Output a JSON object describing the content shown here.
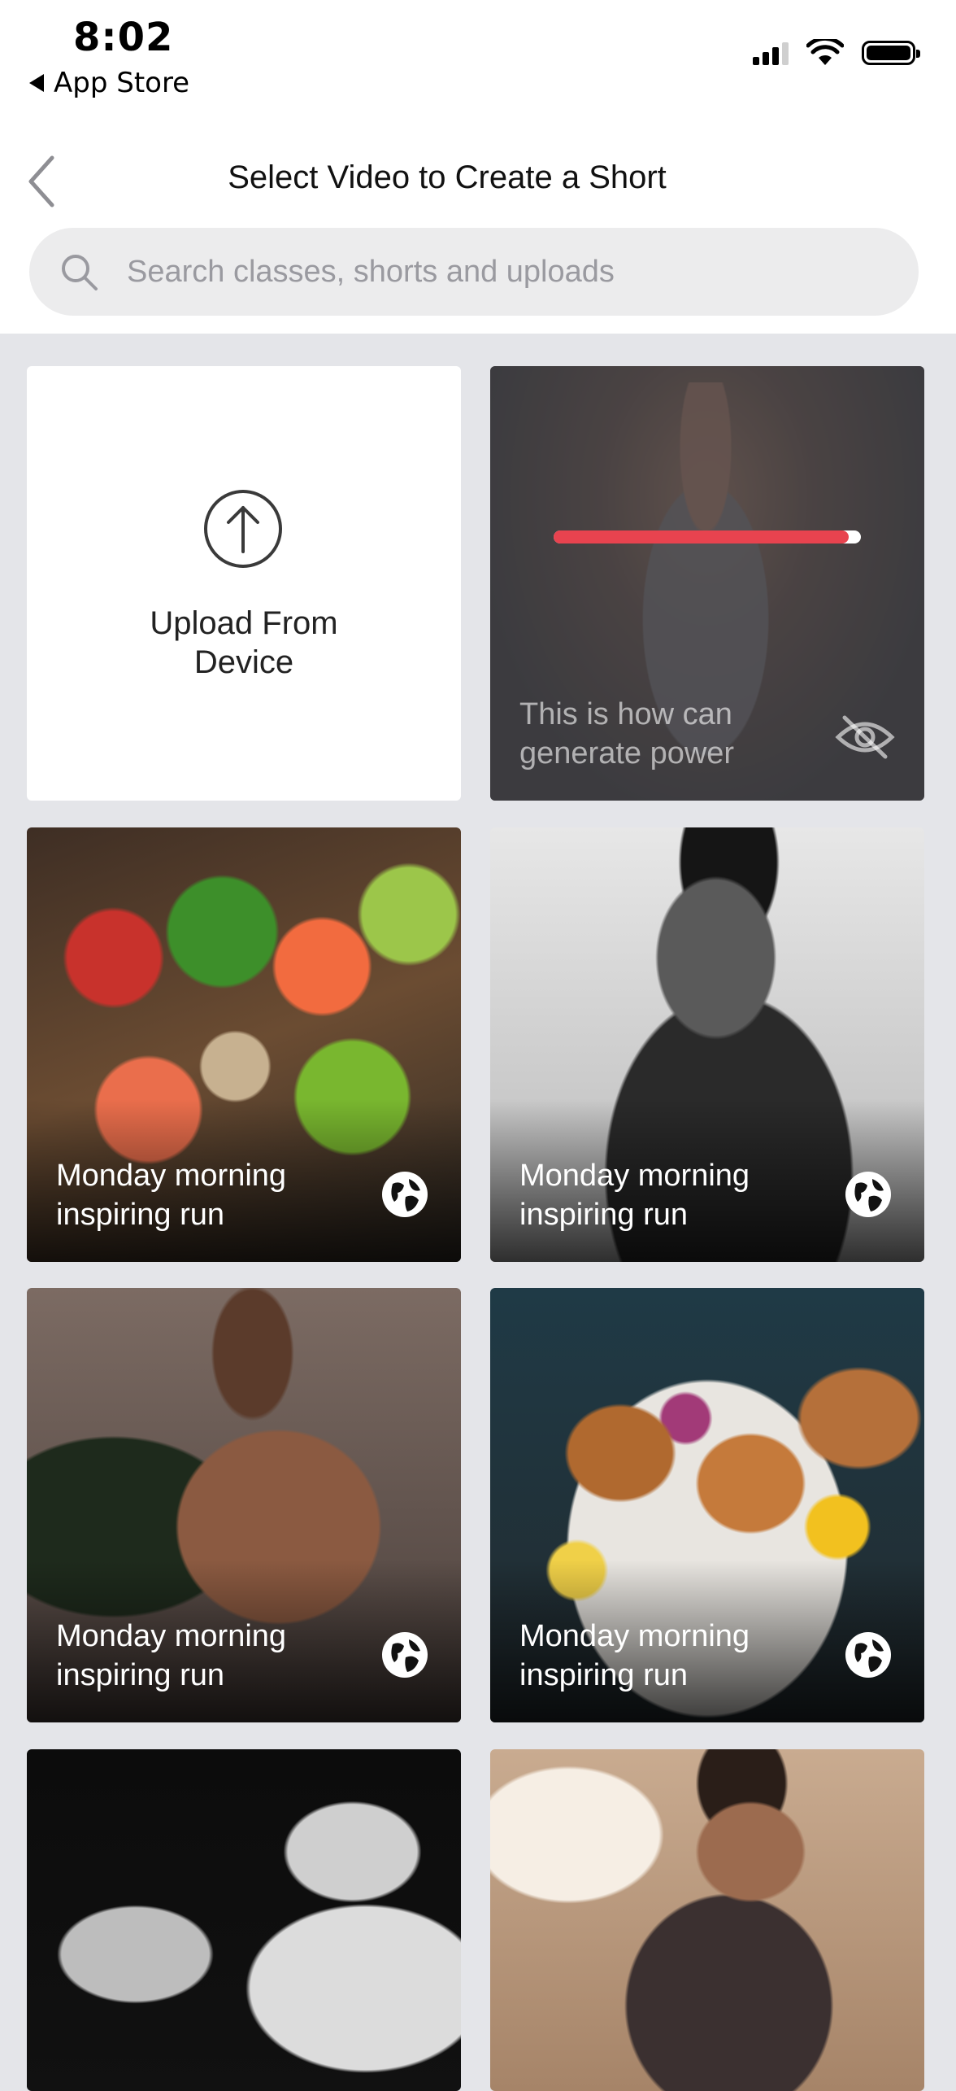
{
  "status_bar": {
    "time": "8:02",
    "back_app": "App Store"
  },
  "nav": {
    "title": "Select Video to Create a Short"
  },
  "search": {
    "placeholder": "Search classes, shorts and uploads"
  },
  "upload_tile": {
    "label_line1": "Upload From",
    "label_line2": "Device"
  },
  "processing_tile": {
    "caption_line1": "This is how can",
    "caption_line2": "generate power",
    "progress_fraction": 0.96
  },
  "tiles": [
    {
      "caption_line1": "Monday morning",
      "caption_line2": "inspiring run"
    },
    {
      "caption_line1": "Monday morning",
      "caption_line2": "inspiring run"
    },
    {
      "caption_line1": "Monday morning",
      "caption_line2": "inspiring run"
    },
    {
      "caption_line1": "Monday morning",
      "caption_line2": "inspiring run"
    }
  ],
  "colors": {
    "accent_red": "#e8434f",
    "background": "#e4e5e9"
  }
}
